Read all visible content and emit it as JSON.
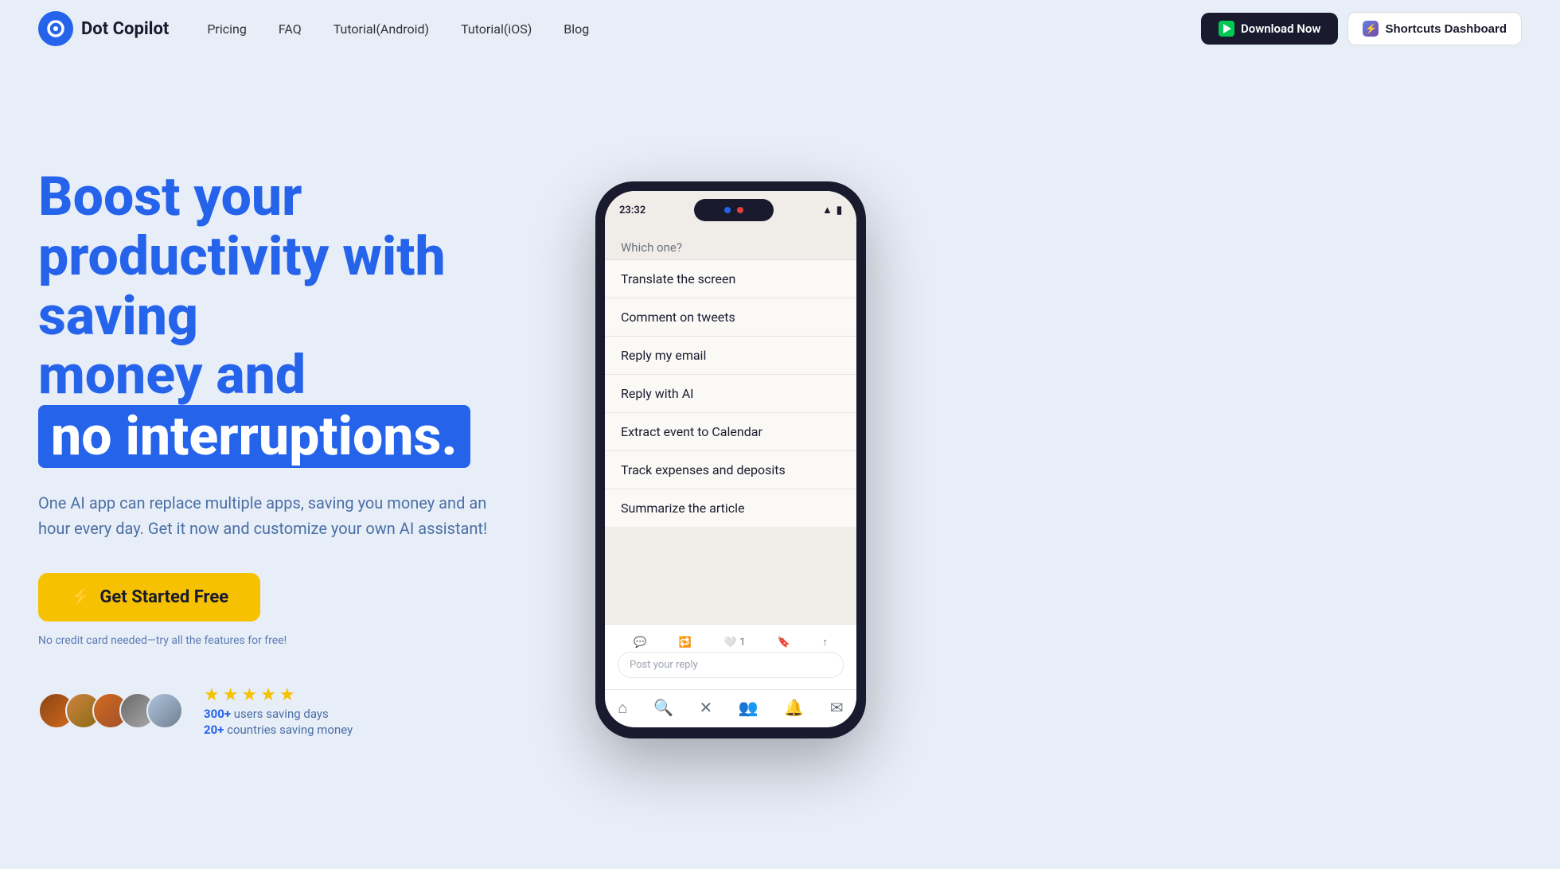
{
  "brand": {
    "name": "Dot Copilot",
    "logo_alt": "Dot Copilot logo"
  },
  "nav": {
    "links": [
      {
        "id": "pricing",
        "label": "Pricing"
      },
      {
        "id": "faq",
        "label": "FAQ"
      },
      {
        "id": "tutorial-android",
        "label": "Tutorial(Android)"
      },
      {
        "id": "tutorial-ios",
        "label": "Tutorial(iOS)"
      },
      {
        "id": "blog",
        "label": "Blog"
      }
    ],
    "download_label": "Download Now",
    "shortcuts_label": "Shortcuts Dashboard"
  },
  "hero": {
    "headline_line1": "Boost your productivity with saving",
    "headline_line2": "money and",
    "highlight": "no interruptions.",
    "subtext": "One AI app can replace multiple apps, saving you money and an hour every day. Get it now and customize your own AI assistant!",
    "cta_label": "Get Started Free",
    "no_cc_text": "No credit card needed—try all the features for free!",
    "social_proof": {
      "users_count": "300+",
      "users_label": "users saving days",
      "countries_count": "20+",
      "countries_label": "countries saving money",
      "stars": [
        "★",
        "★",
        "★",
        "★",
        "★"
      ]
    }
  },
  "phone": {
    "status_time": "23:32",
    "context_menu": {
      "header": "Which one?",
      "items": [
        "Translate the screen",
        "Comment on tweets",
        "Reply my email",
        "Reply with AI",
        "Extract event to Calendar",
        "Track expenses and deposits",
        "Summarize the article"
      ]
    },
    "reply_placeholder": "Post your reply"
  },
  "colors": {
    "primary": "#2563eb",
    "cta": "#f5c100",
    "bg": "#e8eef8",
    "dark": "#1a1a2e"
  }
}
